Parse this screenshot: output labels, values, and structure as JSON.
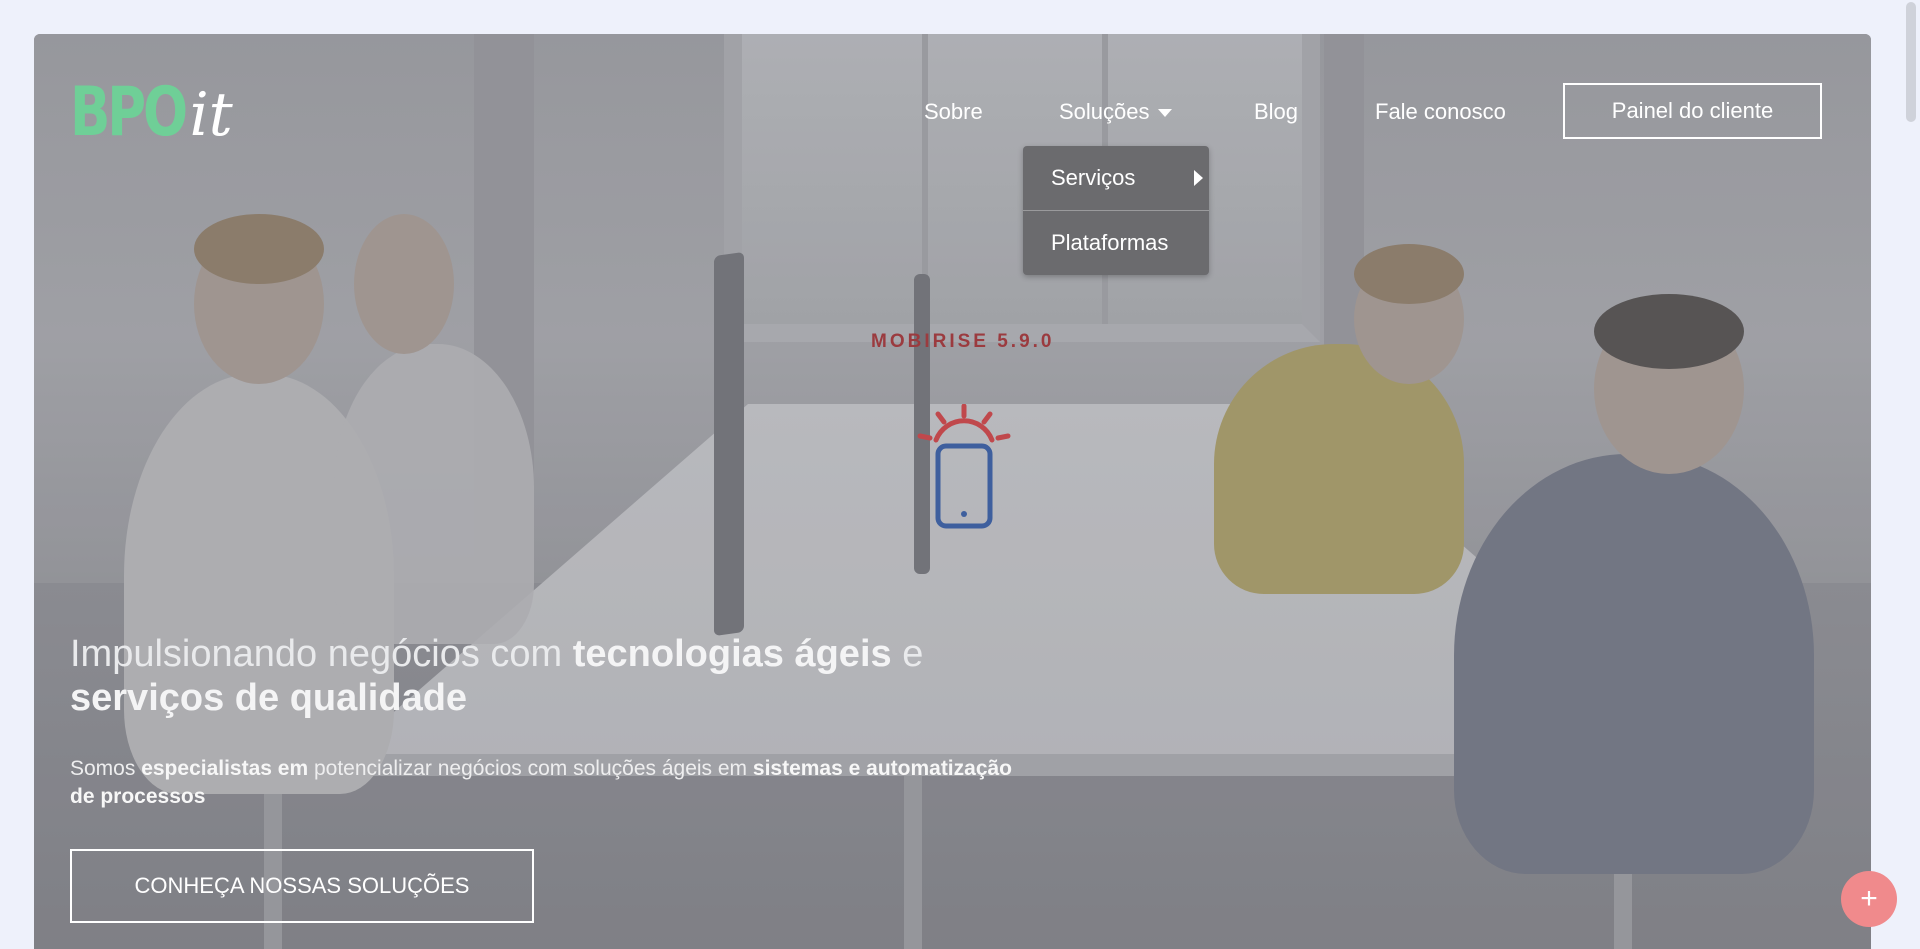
{
  "logo": {
    "part1": "BPO",
    "part2": "it"
  },
  "nav": {
    "about": "Sobre",
    "solutions": "Soluções",
    "blog": "Blog",
    "contact": "Fale conosco",
    "client_panel": "Painel do cliente"
  },
  "dropdown": {
    "items": [
      "Serviços",
      "Plataformas"
    ]
  },
  "loader": {
    "text": "MOBIRISE 5.9.0"
  },
  "hero": {
    "headline_1": "Impulsionando negócios com ",
    "headline_bold_1": "tecnologias ágeis",
    "headline_2": " e ",
    "headline_bold_2": "serviços de qualidade",
    "sub_1": "Somos ",
    "sub_bold_1": "especialistas em",
    "sub_2": " potencializar negócios com soluções ágeis em ",
    "sub_bold_2": "sistemas e automatização de processos",
    "cta": "CONHEÇA NOSSAS SOLUÇÕES"
  },
  "fab": {
    "label": "+"
  },
  "colors": {
    "logo_green": "#6fcf97",
    "loader_red": "#9b3b3f",
    "fab_pink": "#f08a8c",
    "dropdown_bg": "#6b6b6e"
  }
}
